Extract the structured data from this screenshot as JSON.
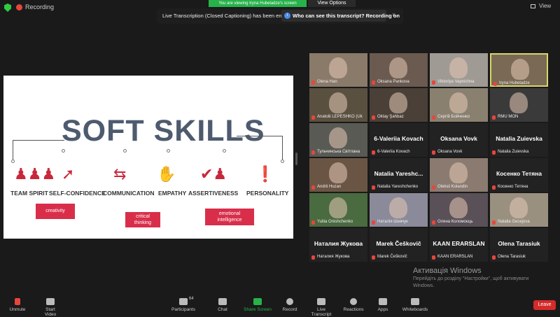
{
  "topbar": {
    "recording_label": "Recording",
    "share_banner": "You are viewing Iryna Hubeladze's screen",
    "view_options": "View Options",
    "view_label": "View"
  },
  "notice": {
    "text": "Live Transcription (Closed Captioning) has been enabled",
    "bold": "Who can see this transcript? Recording on",
    "close": "×"
  },
  "slide": {
    "title": "SOFT SKILLS",
    "skills": [
      "TEAM SPIRIT",
      "SELF-CONFIDENCE",
      "COMMUNICATION",
      "EMPATHY",
      "ASSERTIVENESS",
      "PERSONALITY"
    ],
    "boxes": [
      "creativity",
      "critical\nthinking",
      "emotional\nintelligence"
    ]
  },
  "tiles": [
    {
      "name": "Olena Han",
      "big": "",
      "color": "#8a7a6a"
    },
    {
      "name": "Oksana Pankova",
      "big": "",
      "color": "#6a5a50"
    },
    {
      "name": "Viktoriya Vapnichna",
      "big": "",
      "color": "#a09a95"
    },
    {
      "name": "Iryna Hubeladze",
      "big": "",
      "color": "#7a6a55"
    },
    {
      "name": "Anatolii LEPESHKO (Uk",
      "big": "",
      "color": "#5a5040"
    },
    {
      "name": "Oktay Şahbaz",
      "big": "",
      "color": "#4a4038"
    },
    {
      "name": "Сергій Бойченко",
      "big": "",
      "color": "#8a8070"
    },
    {
      "name": "RMU MON",
      "big": "",
      "color": "#3a3a3a"
    },
    {
      "name": "Тульчинська Світлана",
      "big": "",
      "color": "#5a5a55"
    },
    {
      "name": "6-Valeriia Kovach",
      "big": "6-Valeriia Kovach",
      "color": "#222"
    },
    {
      "name": "Oksana Vovk",
      "big": "Oksana Vovk",
      "color": "#222"
    },
    {
      "name": "Natalia Zuievska",
      "big": "Natalia Zuievska",
      "color": "#222"
    },
    {
      "name": "Andrii Huzan",
      "big": "",
      "color": "#6a5545"
    },
    {
      "name": "Natalia Yareshchenko",
      "big": "Natalia  Yareshc...",
      "color": "#222"
    },
    {
      "name": "Oleksii Kolandin",
      "big": "",
      "color": "#8a7a70"
    },
    {
      "name": "Косенко Тетяна",
      "big": "Косенко Тетяна",
      "color": "#222"
    },
    {
      "name": "Yuliia Onishchenko",
      "big": "",
      "color": "#4a6a40"
    },
    {
      "name": "Наталія Шевчук",
      "big": "",
      "color": "#8a8a9a"
    },
    {
      "name": "Олена Коломоєць",
      "big": "",
      "color": "#5a5058"
    },
    {
      "name": "Natalia Gecejova",
      "big": "",
      "color": "#9a9080"
    },
    {
      "name": "Наталия Жукова",
      "big": "Наталия Жукова",
      "color": "#222"
    },
    {
      "name": "Marek Češkovič",
      "big": "Marek Češkovič",
      "color": "#222"
    },
    {
      "name": "KAAN ERARSLAN",
      "big": "KAAN ERARSLAN",
      "color": "#222"
    },
    {
      "name": "Olena Tarasiuk",
      "big": "Olena Tarasiuk",
      "color": "#222"
    }
  ],
  "activation": {
    "line1": "Активація Windows",
    "line2": "Перейдіть до розділу \"Настройки\", щоб активувати",
    "line3": "Windows."
  },
  "toolbar": {
    "unmute": "Unmute",
    "start_video": "Start Video",
    "participants": "Participants",
    "participants_count": "64",
    "chat": "Chat",
    "share": "Share Screen",
    "record": "Record",
    "transcript": "Live Transcript",
    "reactions": "Reactions",
    "apps": "Apps",
    "whiteboards": "Whiteboards",
    "leave": "Leave"
  }
}
